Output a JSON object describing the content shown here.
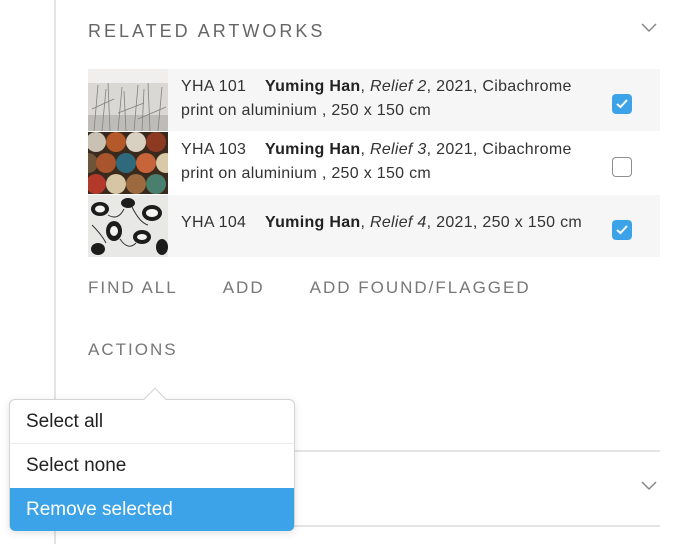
{
  "section": {
    "title": "RELATED ARTWORKS"
  },
  "artworks": [
    {
      "code": "YHA 101",
      "artist": "Yuming Han",
      "title": "Relief 2",
      "details": ", 2021, Cibachrome print on aluminium , 250 x 150 cm",
      "checked": true
    },
    {
      "code": "YHA 103",
      "artist": "Yuming Han",
      "title": "Relief 3",
      "details": ", 2021, Cibachrome print on aluminium , 250 x 150 cm",
      "checked": false
    },
    {
      "code": "YHA 104",
      "artist": "Yuming Han",
      "title": "Relief 4",
      "details": ", 2021, 250 x 150 cm",
      "checked": true
    }
  ],
  "links": {
    "find_all": "FIND ALL",
    "add": "ADD",
    "add_found": "ADD FOUND/FLAGGED"
  },
  "actions": {
    "label": "ACTIONS"
  },
  "menu": {
    "items": [
      "Select all",
      "Select none",
      "Remove selected"
    ],
    "active_color": "#3ca3e8"
  },
  "icons": {
    "collapse": "chevron-down-icon",
    "checked": "checkmark-icon"
  }
}
